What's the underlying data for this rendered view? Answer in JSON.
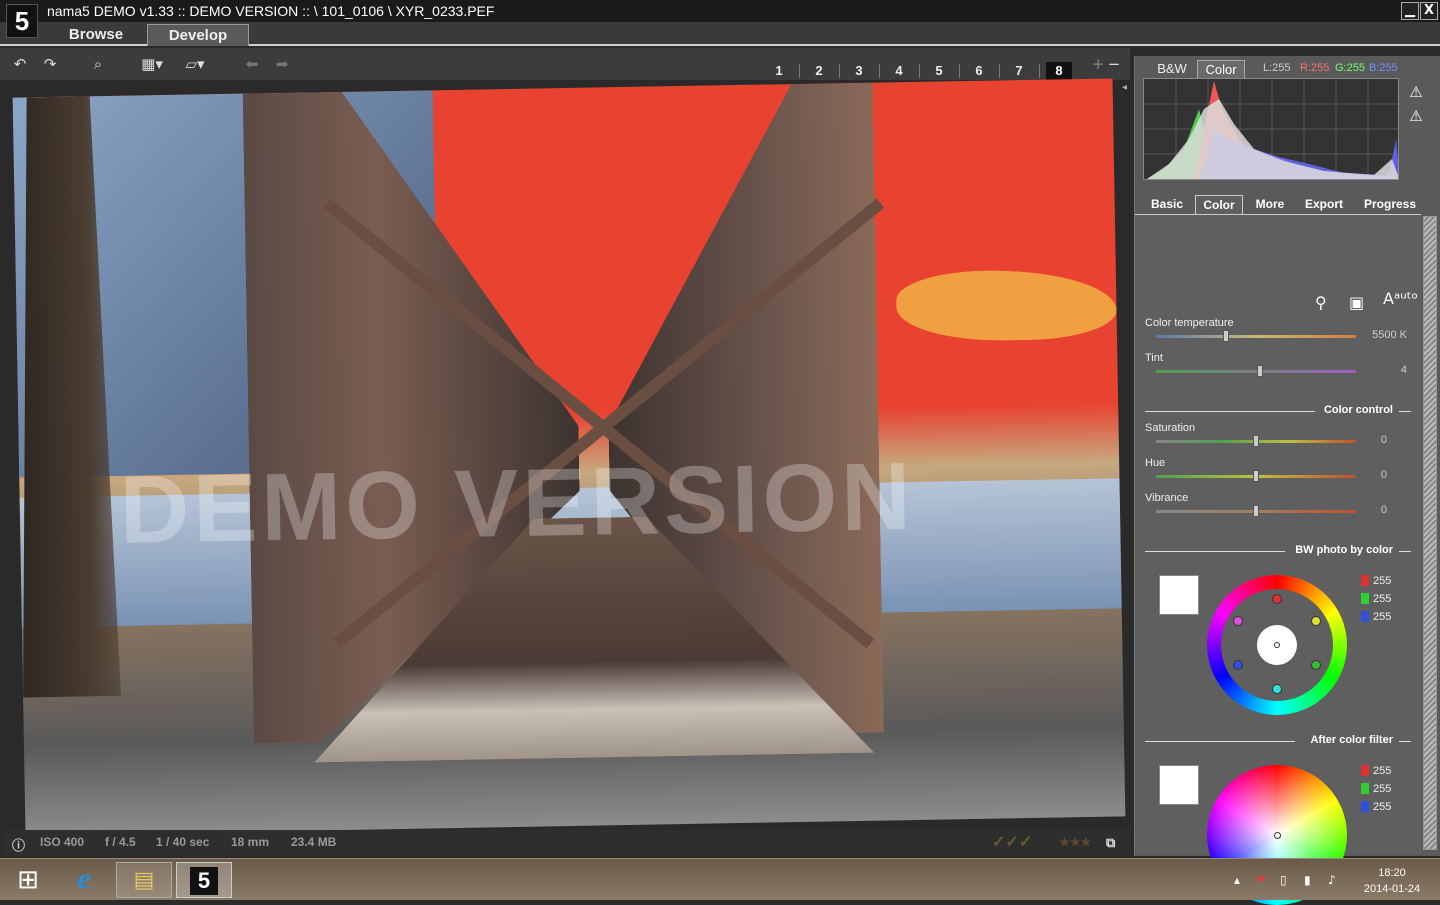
{
  "window": {
    "title": "nama5 DEMO v1.33 :: DEMO VERSION :: \\ 101_0106 \\ XYR_0233.PEF",
    "logo": "5",
    "min_glyph": "▁",
    "close_glyph": "X"
  },
  "tabs": {
    "browse": "Browse",
    "develop": "Develop",
    "active": "Develop"
  },
  "toolbar": {
    "icons": [
      "rotate-left-icon",
      "rotate-right-icon",
      "zoom-icon",
      "grid-icon",
      "crop-angle-icon",
      "undo-icon",
      "redo-icon"
    ],
    "views": [
      "1",
      "2",
      "3",
      "4",
      "5",
      "6",
      "7",
      "8"
    ],
    "active_view": "8",
    "add": "+",
    "remove": "−"
  },
  "photo": {
    "watermark": "DEMO VERSION"
  },
  "status": {
    "iso": "ISO 400",
    "aperture": "f / 4.5",
    "shutter": "1 / 40 sec",
    "focal": "18 mm",
    "size": "23.4 MB",
    "checks": "✓✓✓",
    "stars": "★★★"
  },
  "histogram": {
    "tab_bw": "B&W",
    "tab_color": "Color",
    "active": "Color",
    "L": "L:255",
    "R": "R:255",
    "G": "G:255",
    "B": "B:255",
    "colors": {
      "L": "#cccccc",
      "R": "#ff6060",
      "G": "#60ff60",
      "B": "#6080ff"
    }
  },
  "panel_tabs": [
    "Basic",
    "Color",
    "More",
    "Export",
    "Progress"
  ],
  "panel_active": "Color",
  "color_panel": {
    "temperature": {
      "label": "Color temperature",
      "value": "5500 K",
      "pos": 0.35
    },
    "tint": {
      "label": "Tint",
      "value": "4",
      "pos": 0.52
    },
    "section_control": "Color control",
    "saturation": {
      "label": "Saturation",
      "value": "0",
      "pos": 0.5
    },
    "hue": {
      "label": "Hue",
      "value": "0",
      "pos": 0.5
    },
    "vibrance": {
      "label": "Vibrance",
      "value": "0",
      "pos": 0.5
    },
    "section_bw": "BW photo by color",
    "bw_rgb": [
      "255",
      "255",
      "255"
    ],
    "section_filter": "After color filter",
    "filter_rgb": [
      "255",
      "255",
      "255"
    ]
  },
  "taskbar": {
    "start": "⊞",
    "apps": [
      "internet-explorer",
      "file-explorer",
      "nama5"
    ],
    "time": "18:20",
    "date": "2014-01-24"
  }
}
